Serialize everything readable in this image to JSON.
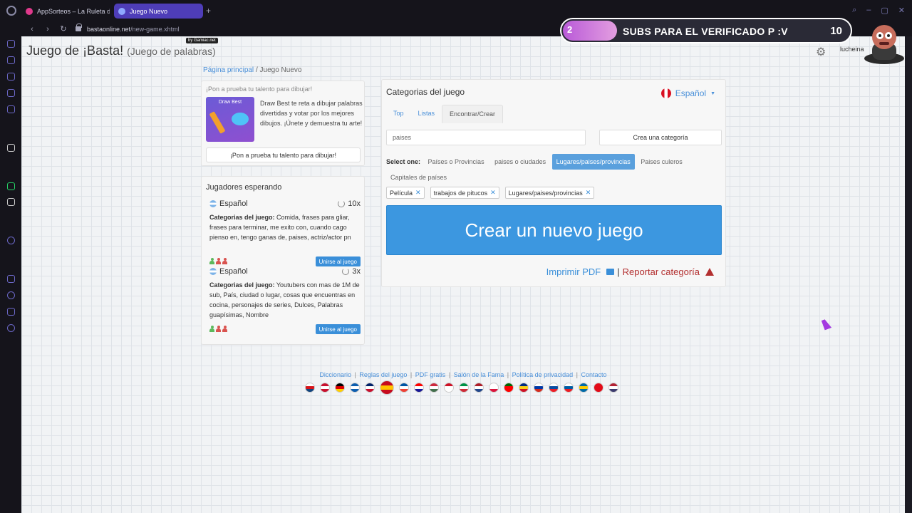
{
  "browser": {
    "tabs": [
      {
        "label": "AppSorteos – La Ruleta d"
      },
      {
        "label": "Juego Nuevo"
      }
    ],
    "url_host": "bastaonline.net",
    "url_path": "/new-game.xhtml",
    "new_tab": "+"
  },
  "overlay": {
    "left_num": "2",
    "text": "SUBS PARA EL VERIFICADO P :V",
    "count": "10"
  },
  "page": {
    "badge": "by Gamiac.net",
    "title": "Juego de ¡Basta!",
    "subtitle": "(Juego de palabras)",
    "user": "lucheina",
    "breadcrumbs": {
      "home": "Página principal",
      "sep": "/",
      "current": "Juego Nuevo"
    }
  },
  "promo": {
    "heading": "¡Pon a prueba tu talento para dibujar!",
    "image_label": "Draw Best",
    "text": "Draw Best te reta a dibujar palabras divertidas y votar por los mejores dibujos. ¡Únete y demuestra tu arte!",
    "button": "¡Pon a prueba tu talento para dibujar!"
  },
  "waiting": {
    "title": "Jugadores esperando",
    "rooms": [
      {
        "lang": "Español",
        "rounds": "10x",
        "cats_label": "Categorias del juego:",
        "cats": "Comida, frases para gliar, frases para terminar, me exito con, cuando cago pienso en, tengo ganas de, paises, actriz/actor pn",
        "join": "Unirse al juego",
        "players": [
          "#5cb85c",
          "#d9534f",
          "#d9534f"
        ]
      },
      {
        "lang": "Español",
        "rounds": "3x",
        "cats_label": "Categorias del juego:",
        "cats": "Youtubers con mas de 1M de sub, País, ciudad o lugar, cosas que encuentras en cocina, personajes de series, Dulces, Palabras guapísimas, Nombre",
        "join": "Unirse al juego",
        "players": [
          "#5cb85c",
          "#d9534f",
          "#d9534f"
        ]
      }
    ]
  },
  "categories": {
    "title": "Categorias del juego",
    "language": "Español",
    "tabs": [
      "Top",
      "Listas",
      "Encontrar/Crear"
    ],
    "active_tab": "Encontrar/Crear",
    "search_value": "paises",
    "create_button": "Crea una categoría",
    "select_label": "Select one:",
    "options": [
      {
        "label": "Países o Provincias",
        "selected": false
      },
      {
        "label": "paises o ciudades",
        "selected": false
      },
      {
        "label": "Lugares/paises/provincias",
        "selected": true
      },
      {
        "label": "Paises culeros",
        "selected": false
      },
      {
        "label": "Capitales de países",
        "selected": false
      }
    ],
    "chips": [
      "Película",
      "trabajos de pitucos",
      "Lugares/paises/provincias"
    ],
    "new_game": "Crear un nuevo juego",
    "print": "Imprimir PDF",
    "separator": "|",
    "report": "Reportar categoría"
  },
  "footer": {
    "links": [
      "Diccionario",
      "Reglas del juego",
      "PDF gratis",
      "Salón de la Fama",
      "Política de privacidad",
      "Contacto"
    ],
    "separator": "|",
    "flags": [
      {
        "name": "czech",
        "colors": [
          "#ffffff",
          "#d7141a",
          "#11457e"
        ]
      },
      {
        "name": "denmark",
        "colors": [
          "#c8102e",
          "#ffffff",
          "#c8102e"
        ]
      },
      {
        "name": "germany",
        "colors": [
          "#000000",
          "#dd0000",
          "#ffce00"
        ]
      },
      {
        "name": "greece",
        "colors": [
          "#0d5eaf",
          "#ffffff",
          "#0d5eaf"
        ]
      },
      {
        "name": "uk",
        "colors": [
          "#012169",
          "#ffffff",
          "#c8102e"
        ]
      },
      {
        "name": "spain",
        "colors": [
          "#c60b1e",
          "#ffc400",
          "#c60b1e"
        ],
        "big": true
      },
      {
        "name": "france",
        "colors": [
          "#0055a4",
          "#ffffff",
          "#ef4135"
        ]
      },
      {
        "name": "croatia",
        "colors": [
          "#ff0000",
          "#ffffff",
          "#171796"
        ]
      },
      {
        "name": "hungary",
        "colors": [
          "#cd2a3e",
          "#ffffff",
          "#436f4d"
        ]
      },
      {
        "name": "indonesia",
        "colors": [
          "#ce1126",
          "#ffffff",
          "#ffffff"
        ]
      },
      {
        "name": "italy",
        "colors": [
          "#009246",
          "#ffffff",
          "#ce2b37"
        ]
      },
      {
        "name": "netherlands",
        "colors": [
          "#ae1c28",
          "#ffffff",
          "#21468b"
        ]
      },
      {
        "name": "poland",
        "colors": [
          "#ffffff",
          "#ffffff",
          "#dc143c"
        ]
      },
      {
        "name": "portugal",
        "colors": [
          "#006600",
          "#ff0000",
          "#ff0000"
        ]
      },
      {
        "name": "romania",
        "colors": [
          "#002b7f",
          "#fcd116",
          "#ce1126"
        ]
      },
      {
        "name": "russia",
        "colors": [
          "#ffffff",
          "#0039a6",
          "#d52b1e"
        ]
      },
      {
        "name": "slovakia",
        "colors": [
          "#ffffff",
          "#0b4ea2",
          "#ee1c25"
        ]
      },
      {
        "name": "slovenia",
        "colors": [
          "#ffffff",
          "#005da4",
          "#ed1c24"
        ]
      },
      {
        "name": "sweden",
        "colors": [
          "#006aa7",
          "#fecc00",
          "#006aa7"
        ]
      },
      {
        "name": "turkey",
        "colors": [
          "#e30a17",
          "#e30a17",
          "#e30a17"
        ]
      },
      {
        "name": "usa",
        "colors": [
          "#b22234",
          "#ffffff",
          "#3c3b6e"
        ]
      }
    ]
  }
}
